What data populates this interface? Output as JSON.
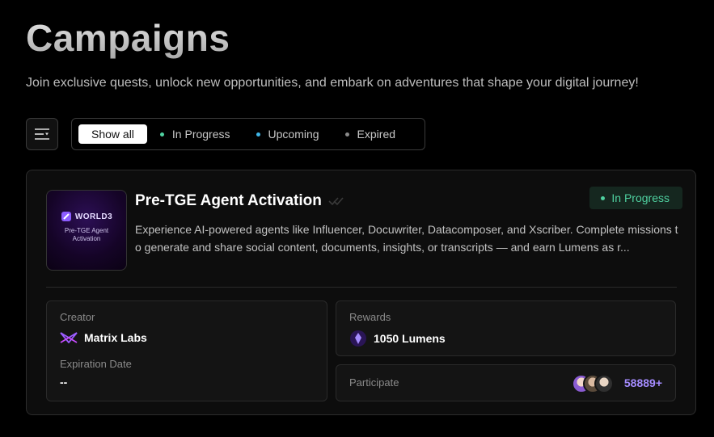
{
  "header": {
    "title": "Campaigns",
    "subtitle": "Join exclusive quests, unlock new opportunities, and embark on adventures that shape your digital journey!"
  },
  "filter": {
    "icon": "filter-menu-icon",
    "tabs": [
      {
        "label": "Show all",
        "active": true,
        "dot_color": null
      },
      {
        "label": "In Progress",
        "active": false,
        "dot_color": "#4fd1a0"
      },
      {
        "label": "Upcoming",
        "active": false,
        "dot_color": "#3fb6e8"
      },
      {
        "label": "Expired",
        "active": false,
        "dot_color": "#8a8a8a"
      }
    ]
  },
  "campaign": {
    "thumbnail": {
      "logo_text": "WORLD3",
      "line1": "Pre-TGE Agent",
      "line2": "Activation"
    },
    "title": "Pre-TGE Agent Activation",
    "status": "In Progress",
    "description": "Experience AI-powered agents like Influencer, Docuwriter, Datacomposer, and Xscriber. Complete missions to generate and share social content, documents, insights, or transcripts — and earn Lumens as r...",
    "creator_label": "Creator",
    "creator_name": "Matrix Labs",
    "expiration_label": "Expiration Date",
    "expiration_value": "--",
    "rewards_label": "Rewards",
    "rewards_value": "1050 Lumens",
    "participate_label": "Participate",
    "participant_count": "58889+"
  },
  "colors": {
    "accent": "#a58cff",
    "status_green": "#4fd1a0",
    "background": "#000000"
  }
}
